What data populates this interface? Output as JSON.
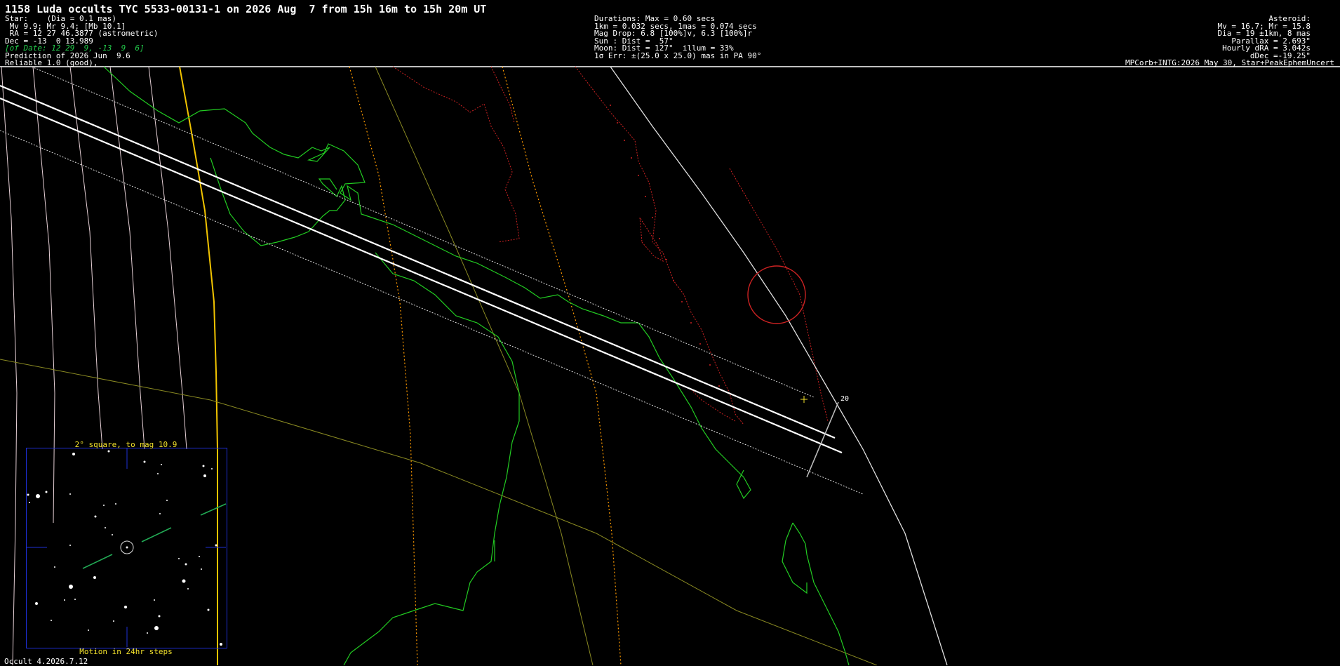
{
  "title": "1158 Luda occults TYC 5533-00131-1 on 2026 Aug  7 from 15h 16m to 15h 20m UT",
  "star_block": {
    "line1": "Star:    (Dia = 0.1 mas)",
    "line2": " Mv 9.9; Mr 9.4; [Mb 10.1]",
    "line3": " RA = 12 27 46.3877 (astrometric)",
    "line4": "Dec = -13  0 13.989",
    "line5": "[of Date: 12 29  9, -13  9  6]",
    "line6": "Prediction of 2026 Jun  9.6",
    "line7": "Reliable 1.0 (good),"
  },
  "durations_block": {
    "line1": "Durations: Max = 0.60 secs",
    "line2": "1km = 0.032 secs, 1mas = 0.074 secs",
    "line3": "Mag Drop: 6.8 [100%]v, 6.3 [100%]r",
    "line4": "Sun : Dist =  57°",
    "line5": "Moon: Dist = 127°  illum = 33%",
    "line6": "1σ Err: ±(25.0 x 25.0) mas in PA 90°"
  },
  "asteroid_block": {
    "line1": "Asteroid:",
    "line2": "Mv = 16.7; Mr = 15.8",
    "line3": "Dia = 19 ±1km, 8 mas",
    "line4": "Parallax = 2.693\"",
    "line5": "Hourly dRA = 3.042s",
    "line6": "dDec =-19.25\"",
    "line7": "MPCorb+INTG:2026 May 30, Star+PeakEphemUncert"
  },
  "finder": {
    "title": "2° square, to mag 10.9",
    "footer": "Motion in 24hr steps"
  },
  "scale_label": "20",
  "version": "Occult 4.2026.7.12",
  "colors": {
    "coastline": "#22cc22",
    "path": "#ffffff",
    "limits": "#dddddd",
    "meridians": "#e6d0d6",
    "zone_line": "#f2c400",
    "dotted_orange": "#ff9a00",
    "red_dotted": "#cc2222",
    "olive": "#8a8a22",
    "finder_border": "#1e2fd6",
    "finder_text": "#f2e12c"
  }
}
